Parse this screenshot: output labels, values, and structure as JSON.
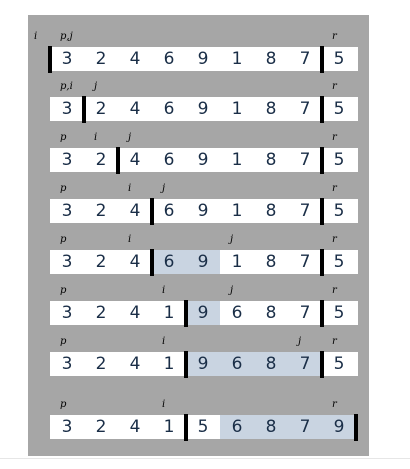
{
  "corner_label": "i",
  "rows": [
    {
      "values": [
        "3",
        "2",
        "4",
        "6",
        "9",
        "1",
        "8",
        "7",
        "5"
      ],
      "labels": [
        {
          "col": 0,
          "text": "p,j"
        },
        {
          "col": 8,
          "text": "r"
        }
      ]
    },
    {
      "values": [
        "3",
        "2",
        "4",
        "6",
        "9",
        "1",
        "8",
        "7",
        "5"
      ],
      "labels": [
        {
          "col": 0,
          "text": "p,i"
        },
        {
          "col": 1,
          "text": "j"
        },
        {
          "col": 8,
          "text": "r"
        }
      ]
    },
    {
      "values": [
        "3",
        "2",
        "4",
        "6",
        "9",
        "1",
        "8",
        "7",
        "5"
      ],
      "labels": [
        {
          "col": 0,
          "text": "p"
        },
        {
          "col": 1,
          "text": "i"
        },
        {
          "col": 2,
          "text": "j"
        },
        {
          "col": 8,
          "text": "r"
        }
      ]
    },
    {
      "values": [
        "3",
        "2",
        "4",
        "6",
        "9",
        "1",
        "8",
        "7",
        "5"
      ],
      "labels": [
        {
          "col": 0,
          "text": "p"
        },
        {
          "col": 2,
          "text": "i"
        },
        {
          "col": 3,
          "text": "j"
        },
        {
          "col": 8,
          "text": "r"
        }
      ]
    },
    {
      "values": [
        "3",
        "2",
        "4",
        "6",
        "9",
        "1",
        "8",
        "7",
        "5"
      ],
      "labels": [
        {
          "col": 0,
          "text": "p"
        },
        {
          "col": 2,
          "text": "i"
        },
        {
          "col": 5,
          "text": "j"
        },
        {
          "col": 8,
          "text": "r"
        }
      ]
    },
    {
      "values": [
        "3",
        "2",
        "4",
        "1",
        "9",
        "6",
        "8",
        "7",
        "5"
      ],
      "labels": [
        {
          "col": 0,
          "text": "p"
        },
        {
          "col": 3,
          "text": "i"
        },
        {
          "col": 5,
          "text": "j"
        },
        {
          "col": 8,
          "text": "r"
        }
      ]
    },
    {
      "values": [
        "3",
        "2",
        "4",
        "1",
        "9",
        "6",
        "8",
        "7",
        "5"
      ],
      "labels": [
        {
          "col": 0,
          "text": "p"
        },
        {
          "col": 3,
          "text": "i"
        },
        {
          "col": 7,
          "text": "j"
        },
        {
          "col": 8,
          "text": "r"
        }
      ]
    },
    {
      "values": [
        "3",
        "2",
        "4",
        "1",
        "5",
        "6",
        "8",
        "7",
        "9"
      ],
      "labels": [
        {
          "col": 0,
          "text": "p"
        },
        {
          "col": 3,
          "text": "i"
        },
        {
          "col": 8,
          "text": "r"
        }
      ]
    }
  ]
}
